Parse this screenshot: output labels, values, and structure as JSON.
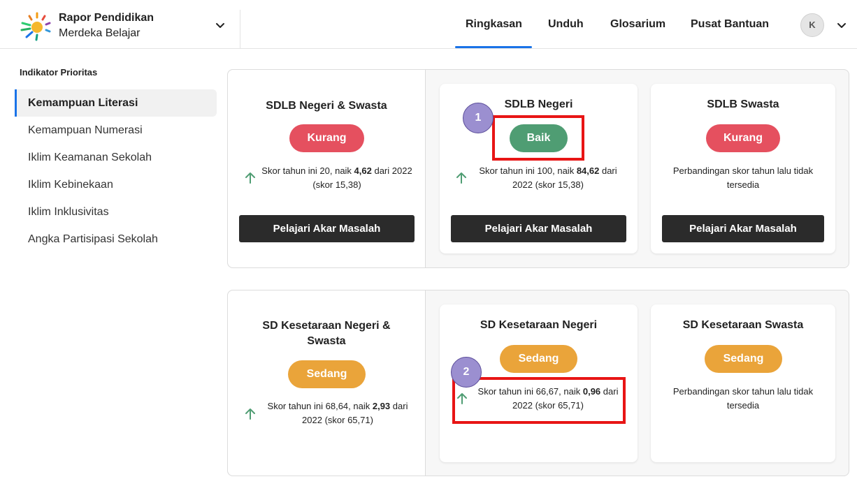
{
  "header": {
    "brand_line1": "Rapor Pendidikan",
    "brand_line2": "Merdeka Belajar",
    "nav": [
      "Ringkasan",
      "Unduh",
      "Glosarium",
      "Pusat Bantuan"
    ],
    "avatar_initial": "K"
  },
  "sidebar": {
    "title": "Indikator Prioritas",
    "items": [
      "Kemampuan Literasi",
      "Kemampuan Numerasi",
      "Iklim Keamanan Sekolah",
      "Iklim Kebinekaan",
      "Iklim Inklusivitas",
      "Angka Partisipasi Sekolah"
    ]
  },
  "panel1": {
    "left": {
      "title": "SDLB Negeri & Swasta",
      "badge": "Kurang",
      "score_pre": "Skor tahun ini 20, naik ",
      "score_bold": "4,62",
      "score_post": " dari 2022 (skor 15,38)",
      "button": "Pelajari Akar Masalah"
    },
    "mid": {
      "title": "SDLB Negeri",
      "badge": "Baik",
      "score_pre": "Skor tahun ini 100, naik ",
      "score_bold": "84,62",
      "score_post": " dari 2022 (skor 15,38)",
      "button": "Pelajari Akar Masalah"
    },
    "right": {
      "title": "SDLB Swasta",
      "badge": "Kurang",
      "score_text": "Perbandingan skor tahun lalu tidak tersedia",
      "button": "Pelajari Akar Masalah"
    }
  },
  "panel2": {
    "left": {
      "title": "SD Kesetaraan Negeri & Swasta",
      "badge": "Sedang",
      "score_pre": "Skor tahun ini 68,64, naik ",
      "score_bold": "2,93",
      "score_post": " dari 2022 (skor 65,71)"
    },
    "mid": {
      "title": "SD Kesetaraan Negeri",
      "badge": "Sedang",
      "score_pre": "Skor tahun ini 66,67, naik ",
      "score_bold": "0,96",
      "score_post": " dari 2022 (skor 65,71)"
    },
    "right": {
      "title": "SD Kesetaraan Swasta",
      "badge": "Sedang",
      "score_text": "Perbandingan skor tahun lalu tidak tersedia"
    }
  },
  "annotations": {
    "marker1": "1",
    "marker2": "2"
  },
  "colors": {
    "accent": "#1a73e8",
    "kurang": "#e5505f",
    "baik": "#4f9d73",
    "sedang": "#eaa43a",
    "highlight": "#e81515",
    "up_arrow": "#4f9d73"
  },
  "icons": {
    "logo": "sun-logo-icon",
    "chevron": "chevron-down-icon",
    "trend": "arrow-up-icon"
  }
}
